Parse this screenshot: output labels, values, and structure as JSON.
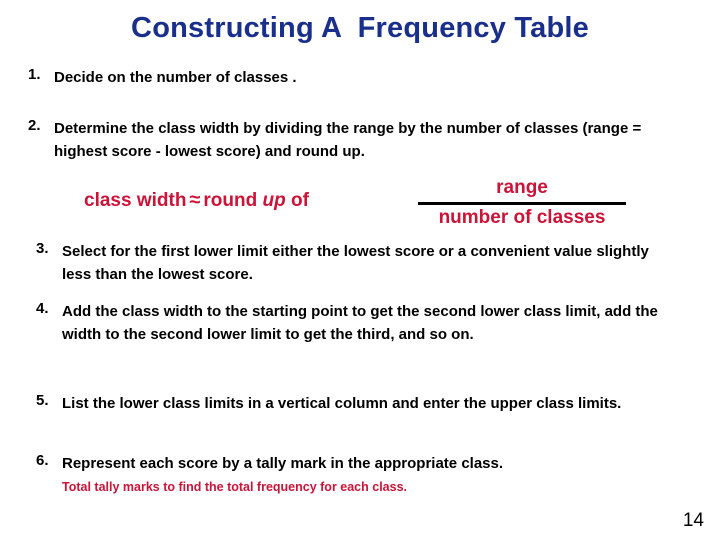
{
  "slide": {
    "title": "Constructing A  Frequency Table",
    "page_number": "14",
    "colors": {
      "title": "#1a2f8c",
      "body": "#000000",
      "accent": "#cc1338",
      "background": "#ffffff",
      "fraction_bar": "#000000"
    }
  },
  "steps": [
    {
      "number": "1.",
      "text": "Decide on the number of classes ."
    },
    {
      "number": "2.",
      "text": "Determine the class width by dividing the range by the number of classes  (range =  highest score -  lowest score) and round up."
    },
    {
      "number": "3.",
      "text": "Select for the first lower limit either the lowest score or a convenient value slightly less than the lowest score."
    },
    {
      "number": "4.",
      "text": "Add the class width to the starting point to get the second lower class limit, add the width to the second lower limit to get the third, and so on."
    },
    {
      "number": "5.",
      "text": "List  the lower class limits in a vertical column and enter the upper class limits."
    },
    {
      "number": "6.",
      "text": "Represent each score by a tally mark in the appropriate class.",
      "subnote": "Total tally marks to find the total frequency for each class."
    }
  ],
  "formula": {
    "lhs_text": "class width",
    "approx_symbol": "≈",
    "round_word": "round",
    "up_word": "up",
    "of_word": "of",
    "numerator": "range",
    "denominator": "number of classes"
  }
}
